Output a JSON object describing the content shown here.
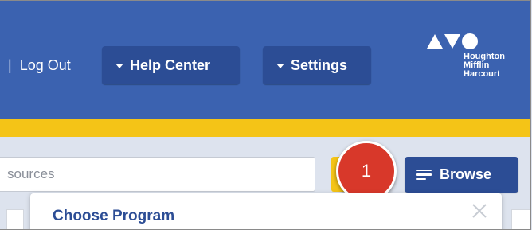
{
  "header": {
    "separator": "|",
    "logout_label": "Log Out",
    "help_center_label": "Help Center",
    "settings_label": "Settings",
    "brand_lines": [
      "Houghton",
      "Mifflin",
      "Harcourt"
    ]
  },
  "search": {
    "placeholder_visible": "sources"
  },
  "browse": {
    "label": "Browse"
  },
  "callout": {
    "number": "1"
  },
  "panel": {
    "title": "Choose Program"
  },
  "icons": {
    "caret": "caret-down-icon",
    "browse": "menu-lines-icon",
    "close": "close-icon"
  },
  "colors": {
    "header_blue": "#3b62b0",
    "button_blue": "#2c4d95",
    "accent_yellow": "#f4c417",
    "callout_red": "#d8382a",
    "page_bg": "#dde3ee"
  }
}
